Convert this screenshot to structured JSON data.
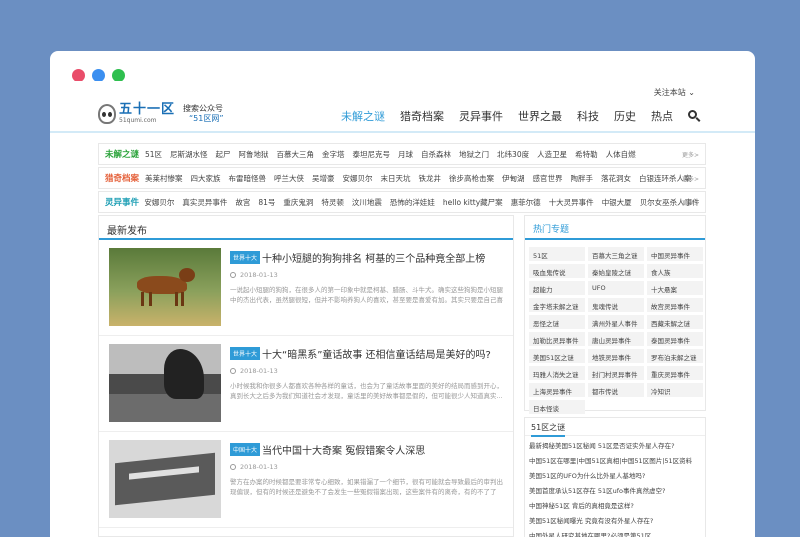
{
  "header": {
    "follow": "关注本站",
    "logo_main": "五十一区",
    "logo_sub": "51qumi.com",
    "slogan_1": "搜索公众号",
    "slogan_2": "“51区网”"
  },
  "nav": [
    "未解之谜",
    "猎奇档案",
    "灵异事件",
    "世界之最",
    "科技",
    "历史",
    "热点"
  ],
  "categories": [
    {
      "label": "未解之谜",
      "links": [
        "51区",
        "尼斯湖水怪",
        "起尸",
        "阿鲁地狱",
        "百慕大三角",
        "金字塔",
        "泰坦尼克号",
        "月球",
        "自杀森林",
        "地狱之门",
        "北纬30度",
        "人造卫星",
        "希特勒",
        "人体自燃"
      ]
    },
    {
      "label": "猎奇档案",
      "links": [
        "美莱村惨案",
        "四大家族",
        "布雷暗怪兽",
        "呼兰大侠",
        "吴增豪",
        "安娜贝尔",
        "末日天坑",
        "铁龙井",
        "徐步高枪击案",
        "伊甸湖",
        "感官世界",
        "陶胖手",
        "落花洞女",
        "白银连环杀人案"
      ]
    },
    {
      "label": "灵异事件",
      "links": [
        "安娜贝尔",
        "真实灵异事件",
        "故宫",
        "81号",
        "重庆鬼洞",
        "特灵顿",
        "汶川地震",
        "恐怖的洋娃娃",
        "hello kitty藏尸案",
        "惠菲尔德",
        "十大灵异事件",
        "中银大厦",
        "贝尔女巫杀人事件"
      ]
    }
  ],
  "more": "更多>",
  "latest": {
    "title": "最新发布",
    "articles": [
      {
        "tag": "世界十大",
        "title": "十种小短腿的狗狗排名 柯基的三个品种竟全部上榜",
        "date": "2018-01-13",
        "excerpt": "一说起小短腿的狗狗，在很多人的第一印象中就是柯基、腊肠、斗牛犬。确实这些狗狗是小短腿中的杰出代表，虽然腿很短，但并不影响养狗人的喜欢，甚至要是喜爱有加。其实只要是自己喜欢的..."
      },
      {
        "tag": "世界十大",
        "title": "十大“暗黑系”童话故事 还相信童话结局是美好的吗?",
        "date": "2018-01-13",
        "excerpt": "小时候我和你很多人都喜欢各种各样的童话，也会为了童话故事里面的美好的结局而感到开心，真到长大之后多为我们知道社会才发现，童话里的美好故事都是假的，但可能很少人知道真实..."
      },
      {
        "tag": "中国十大",
        "title": "当代中国十大奇案 冤假错案令人深思",
        "date": "2018-01-13",
        "excerpt": "警方在办案的时候都是要非常专心细致，如果错漏了一个细节，很有可能就会导致最后的审判出现偏误，但有的时候还是避免不了会发生一些冤假错案出现，这些案件有的离奇，有的不了了之，有..."
      }
    ]
  },
  "hot": {
    "title": "热门专题",
    "items": [
      "51区",
      "百慕大三角之谜",
      "中国灵异事件",
      "吸血鬼传说",
      "秦始皇陵之谜",
      "食人族",
      "超能力",
      "UFO",
      "十大悬案",
      "金字塔未解之谜",
      "鬼魂传说",
      "故宫灵异事件",
      "恶怪之谜",
      "满州外星人事件",
      "西藏未解之谜",
      "加勒比灵异事件",
      "唐山灵异事件",
      "泰国灵异事件",
      "美国51区之谜",
      "地铁灵异事件",
      "罗布泊未解之谜",
      "玛雅人消失之谜",
      "封门村灵异事件",
      "重庆灵异事件",
      "上海灵异事件",
      "都市传说",
      "冷知识",
      "日本怪谈"
    ]
  },
  "area51": {
    "title": "51区之谜",
    "items": [
      "最新揭秘美国51区秘闻 51区是否证实外星人存在?",
      "中国51区在哪里|中国51区真相|中国51区图片|51区资料",
      "美国51区的UFO为什么比外星人基地吗?",
      "美国首度承认51区存在 51区ufo事件真然虚空?",
      "中国神秘51区 背后的真相竟是这样?",
      "美国51区秘闻曝光 究竟有没有外星人存在?",
      "中国外星人研究基地在哪里?必须是第51区"
    ]
  }
}
